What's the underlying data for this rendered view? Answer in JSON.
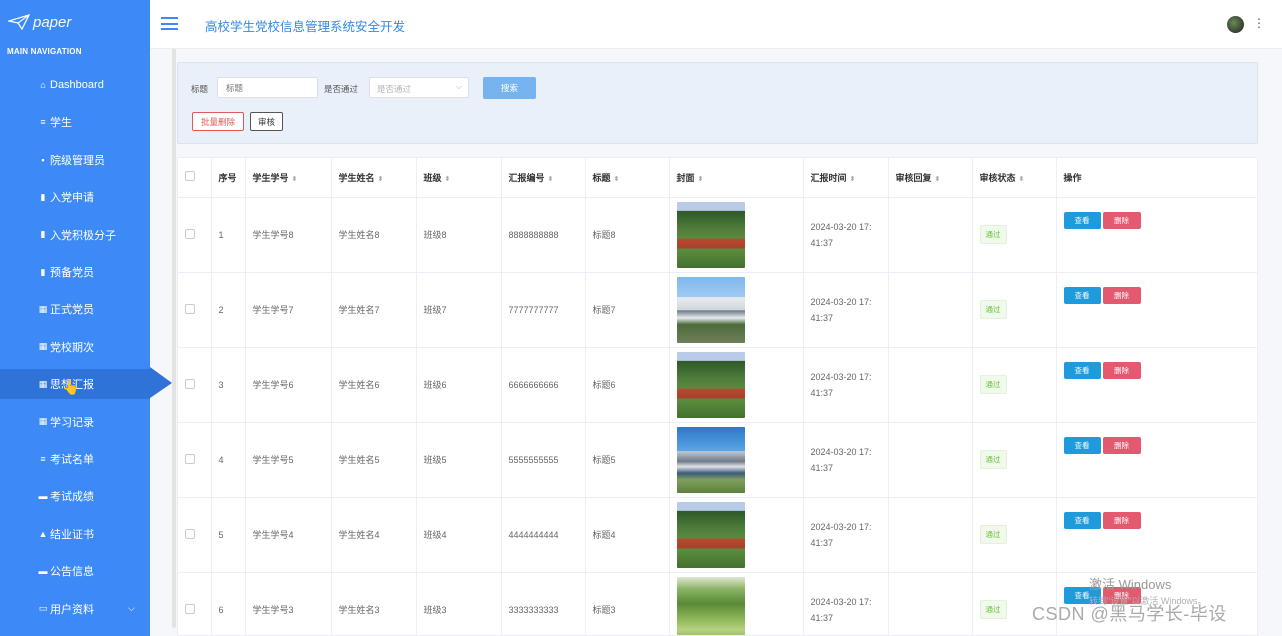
{
  "app": {
    "logo_text": "paper",
    "title": "高校学生党校信息管理系统安全开发"
  },
  "sidebar": {
    "caption": "MAIN NAVIGATION",
    "items": [
      {
        "label": "Dashboard",
        "icon": "home-icon"
      },
      {
        "label": "学生",
        "icon": "list-icon"
      },
      {
        "label": "院级管理员",
        "icon": "card-icon"
      },
      {
        "label": "入党申请",
        "icon": "chart-icon"
      },
      {
        "label": "入党积极分子",
        "icon": "clipboard-icon"
      },
      {
        "label": "预备党员",
        "icon": "clipboard-icon"
      },
      {
        "label": "正式党员",
        "icon": "grid-icon"
      },
      {
        "label": "党校期次",
        "icon": "grid-icon"
      },
      {
        "label": "思想汇报",
        "icon": "grid-icon"
      },
      {
        "label": "学习记录",
        "icon": "grid-icon"
      },
      {
        "label": "考试名单",
        "icon": "list-icon"
      },
      {
        "label": "考试成绩",
        "icon": "comment-icon"
      },
      {
        "label": "结业证书",
        "icon": "user-icon"
      },
      {
        "label": "公告信息",
        "icon": "comment-icon"
      },
      {
        "label": "用户资料",
        "icon": "window-icon"
      }
    ],
    "active_label": "思想汇报"
  },
  "filter": {
    "title_label": "标题",
    "title_placeholder": "标题",
    "passed_label": "是否通过",
    "passed_placeholder": "是否通过",
    "search_button": "搜索",
    "batch_delete_button": "批量删除",
    "audit_button": "审核"
  },
  "table": {
    "columns": [
      "序号",
      "学生学号",
      "学生姓名",
      "班级",
      "汇报编号",
      "标题",
      "封面",
      "汇报时间",
      "审核回复",
      "审核状态",
      "操作"
    ],
    "rows": [
      {
        "index": "1",
        "student_no": "学生学号8",
        "student_name": "学生姓名8",
        "class": "班级8",
        "report_no": "8888888888",
        "title": "标题8",
        "cover": "track",
        "time1": "2024-03-20 17:",
        "time2": "41:37",
        "reply": "",
        "status": "通过"
      },
      {
        "index": "2",
        "student_no": "学生学号7",
        "student_name": "学生姓名7",
        "class": "班级7",
        "report_no": "7777777777",
        "title": "标题7",
        "cover": "bldg",
        "time1": "2024-03-20 17:",
        "time2": "41:37",
        "reply": "",
        "status": "通过"
      },
      {
        "index": "3",
        "student_no": "学生学号6",
        "student_name": "学生姓名6",
        "class": "班级6",
        "report_no": "6666666666",
        "title": "标题6",
        "cover": "track",
        "time1": "2024-03-20 17:",
        "time2": "41:37",
        "reply": "",
        "status": "通过"
      },
      {
        "index": "4",
        "student_no": "学生学号5",
        "student_name": "学生姓名5",
        "class": "班级5",
        "report_no": "5555555555",
        "title": "标题5",
        "cover": "night",
        "time1": "2024-03-20 17:",
        "time2": "41:37",
        "reply": "",
        "status": "通过"
      },
      {
        "index": "5",
        "student_no": "学生学号4",
        "student_name": "学生姓名4",
        "class": "班级4",
        "report_no": "4444444444",
        "title": "标题4",
        "cover": "track",
        "time1": "2024-03-20 17:",
        "time2": "41:37",
        "reply": "",
        "status": "通过"
      },
      {
        "index": "6",
        "student_no": "学生学号3",
        "student_name": "学生姓名3",
        "class": "班级3",
        "report_no": "3333333333",
        "title": "标题3",
        "cover": "park",
        "time1": "2024-03-20 17:",
        "time2": "41:37",
        "reply": "",
        "status": "通过"
      }
    ],
    "view_button": "查看",
    "delete_button": "删除"
  },
  "overlay": {
    "activate_line1": "激活 Windows",
    "activate_line2": "转到\"设置\"以激活 Windows。",
    "csdn": "CSDN @黑马学长-毕设"
  }
}
